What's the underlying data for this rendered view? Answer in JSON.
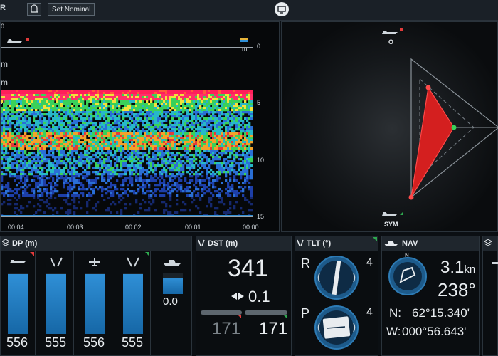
{
  "topbar": {
    "left_label": "R",
    "set_nominal_label": "Set Nominal"
  },
  "echogram": {
    "depth_ticks": [
      "0",
      "5",
      "10",
      "15"
    ],
    "unit_label": "m",
    "time_ticks": [
      "00.04",
      "00.03",
      "00.02",
      "00.01",
      "00.00"
    ],
    "side_labels": [
      "m",
      "m",
      "m"
    ]
  },
  "radar": {
    "top_label": "O",
    "bottom_label": "SYM"
  },
  "panels": {
    "dp": {
      "title": "DP (m)",
      "values": [
        "556",
        "555",
        "556",
        "555"
      ],
      "extra_value": "0.0"
    },
    "dst": {
      "title": "DST (m)",
      "main_value": "341",
      "delta_value": "0.1",
      "left_value": "171",
      "right_value": "171"
    },
    "tlt": {
      "title": "TLT (°)",
      "r_label": "R",
      "r_value": "4",
      "p_label": "P",
      "p_value": "4"
    },
    "nav": {
      "title": "NAV",
      "compass_n": "N",
      "speed": "3.1",
      "speed_unit": "kn",
      "heading": "238°",
      "lat_label": "N:",
      "lat": "62°15.340'",
      "lon_label": "W:",
      "lon": "000°56.643'"
    }
  }
}
